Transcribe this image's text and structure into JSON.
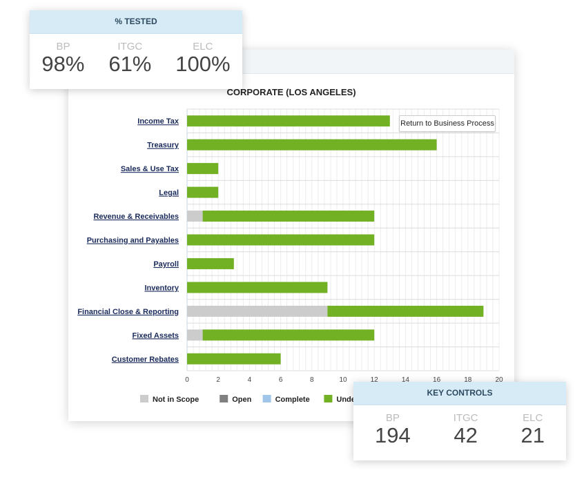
{
  "chart_data": {
    "type": "bar",
    "orientation": "horizontal",
    "stacked": true,
    "title": "CORPORATE (LOS ANGELES)",
    "categories": [
      "Income Tax",
      "Treasury",
      "Sales & Use Tax",
      "Legal",
      "Revenue & Receivables",
      "Purchasing and Payables",
      "Payroll",
      "Inventory",
      "Financial Close & Reporting",
      "Fixed Assets",
      "Customer Rebates"
    ],
    "series": [
      {
        "name": "Not in Scope",
        "color": "#cccccc",
        "values": [
          0,
          0,
          0,
          0,
          1,
          0,
          0,
          0,
          9,
          1,
          0
        ]
      },
      {
        "name": "Open",
        "color": "#808080",
        "values": [
          0,
          0,
          0,
          0,
          0,
          0,
          0,
          0,
          0,
          0,
          0
        ]
      },
      {
        "name": "Complete",
        "color": "#9fc5e8",
        "values": [
          0,
          0,
          0,
          0,
          0,
          0,
          0,
          0,
          0,
          0,
          0
        ]
      },
      {
        "name": "Under",
        "color": "#72b024",
        "values": [
          13,
          16,
          2,
          2,
          11,
          12,
          3,
          9,
          10,
          11,
          6
        ]
      }
    ],
    "xlim": [
      0,
      20
    ],
    "xticks": [
      "0",
      "2",
      "4",
      "6",
      "8",
      "10",
      "12",
      "14",
      "16",
      "18",
      "20"
    ],
    "grid": true,
    "legend": "bottom"
  },
  "return_button": "Return to Business Process",
  "tested_card": {
    "title": "% TESTED",
    "metrics": [
      {
        "label": "BP",
        "value": "98%"
      },
      {
        "label": "ITGC",
        "value": "61%"
      },
      {
        "label": "ELC",
        "value": "100%"
      }
    ]
  },
  "key_card": {
    "title": "KEY CONTROLS",
    "metrics": [
      {
        "label": "BP",
        "value": "194"
      },
      {
        "label": "ITGC",
        "value": "42"
      },
      {
        "label": "ELC",
        "value": "21"
      }
    ]
  }
}
